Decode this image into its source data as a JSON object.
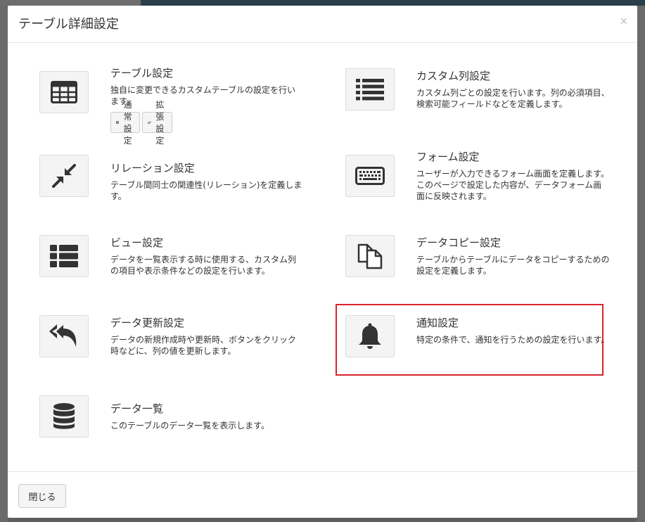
{
  "modal": {
    "title": "テーブル詳細設定",
    "close_icon": "×",
    "close_button": "閉じる"
  },
  "items": [
    {
      "id": "table",
      "title": "テーブル設定",
      "desc": "独自に変更できるカスタムテーブルの設定を行います。",
      "icon": "table-icon",
      "sub_buttons": [
        {
          "label": "通常設定",
          "icon": "table-small-icon"
        },
        {
          "label": "拡張設定",
          "icon": "gears-icon"
        }
      ]
    },
    {
      "id": "column",
      "title": "カスタム列設定",
      "desc": "カスタム列ごとの設定を行います。列の必須項目、検索可能フィールドなどを定義します。",
      "icon": "list-icon"
    },
    {
      "id": "relation",
      "title": "リレーション設定",
      "desc": "テーブル間同士の関連性(リレーション)を定義します。",
      "icon": "compress-icon"
    },
    {
      "id": "form",
      "title": "フォーム設定",
      "desc": "ユーザーが入力できるフォーム画面を定義します。このページで設定した内容が、データフォーム画面に反映されます。",
      "icon": "keyboard-icon"
    },
    {
      "id": "view",
      "title": "ビュー設定",
      "desc": "データを一覧表示する時に使用する、カスタム列の項目や表示条件などの設定を行います。",
      "icon": "th-list-icon"
    },
    {
      "id": "copy",
      "title": "データコピー設定",
      "desc": "テーブルからテーブルにデータをコピーするための設定を定義します。",
      "icon": "copy-icon"
    },
    {
      "id": "operation",
      "title": "データ更新設定",
      "desc": "データの新規作成時や更新時、ボタンをクリック時などに、列の値を更新します。",
      "icon": "reply-all-icon"
    },
    {
      "id": "notify",
      "title": "通知設定",
      "desc": "特定の条件で、通知を行うための設定を行います。",
      "icon": "bell-icon"
    },
    {
      "id": "data",
      "title": "データ一覧",
      "desc": "このテーブルのデータ一覧を表示します。",
      "icon": "database-icon"
    }
  ],
  "colors": {
    "highlight": "#d8232a",
    "icon": "#333333"
  }
}
